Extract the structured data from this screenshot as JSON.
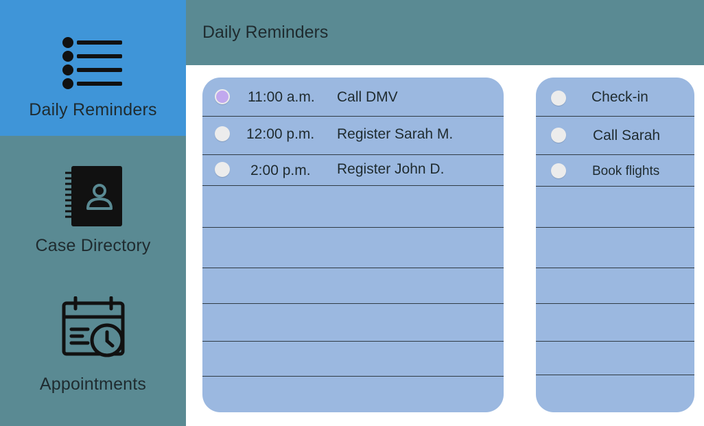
{
  "sidebar": {
    "items": [
      {
        "label": "Daily Reminders",
        "icon": "list-icon",
        "active": true
      },
      {
        "label": "Case Directory",
        "icon": "contact-book-icon",
        "active": false
      },
      {
        "label": "Appointments",
        "icon": "calendar-clock-icon",
        "active": false
      }
    ]
  },
  "header": {
    "title": "Daily Reminders"
  },
  "schedule": {
    "items": [
      {
        "time": "11:00 a.m.",
        "task": "Call DMV",
        "selected": true
      },
      {
        "time": "12:00 p.m.",
        "task": "Register Sarah M.",
        "selected": false
      },
      {
        "time": "2:00 p.m.",
        "task": "Register John D.",
        "selected": false
      }
    ]
  },
  "todos": {
    "items": [
      {
        "label": "Check-in"
      },
      {
        "label": "Call Sarah"
      },
      {
        "label": "Book flights"
      }
    ]
  },
  "colors": {
    "sidebar": "#5a8a93",
    "active_nav": "#3f95d8",
    "panel": "#9bb8e0",
    "radio_selected": "#c1a8ee",
    "radio": "#ececec"
  }
}
